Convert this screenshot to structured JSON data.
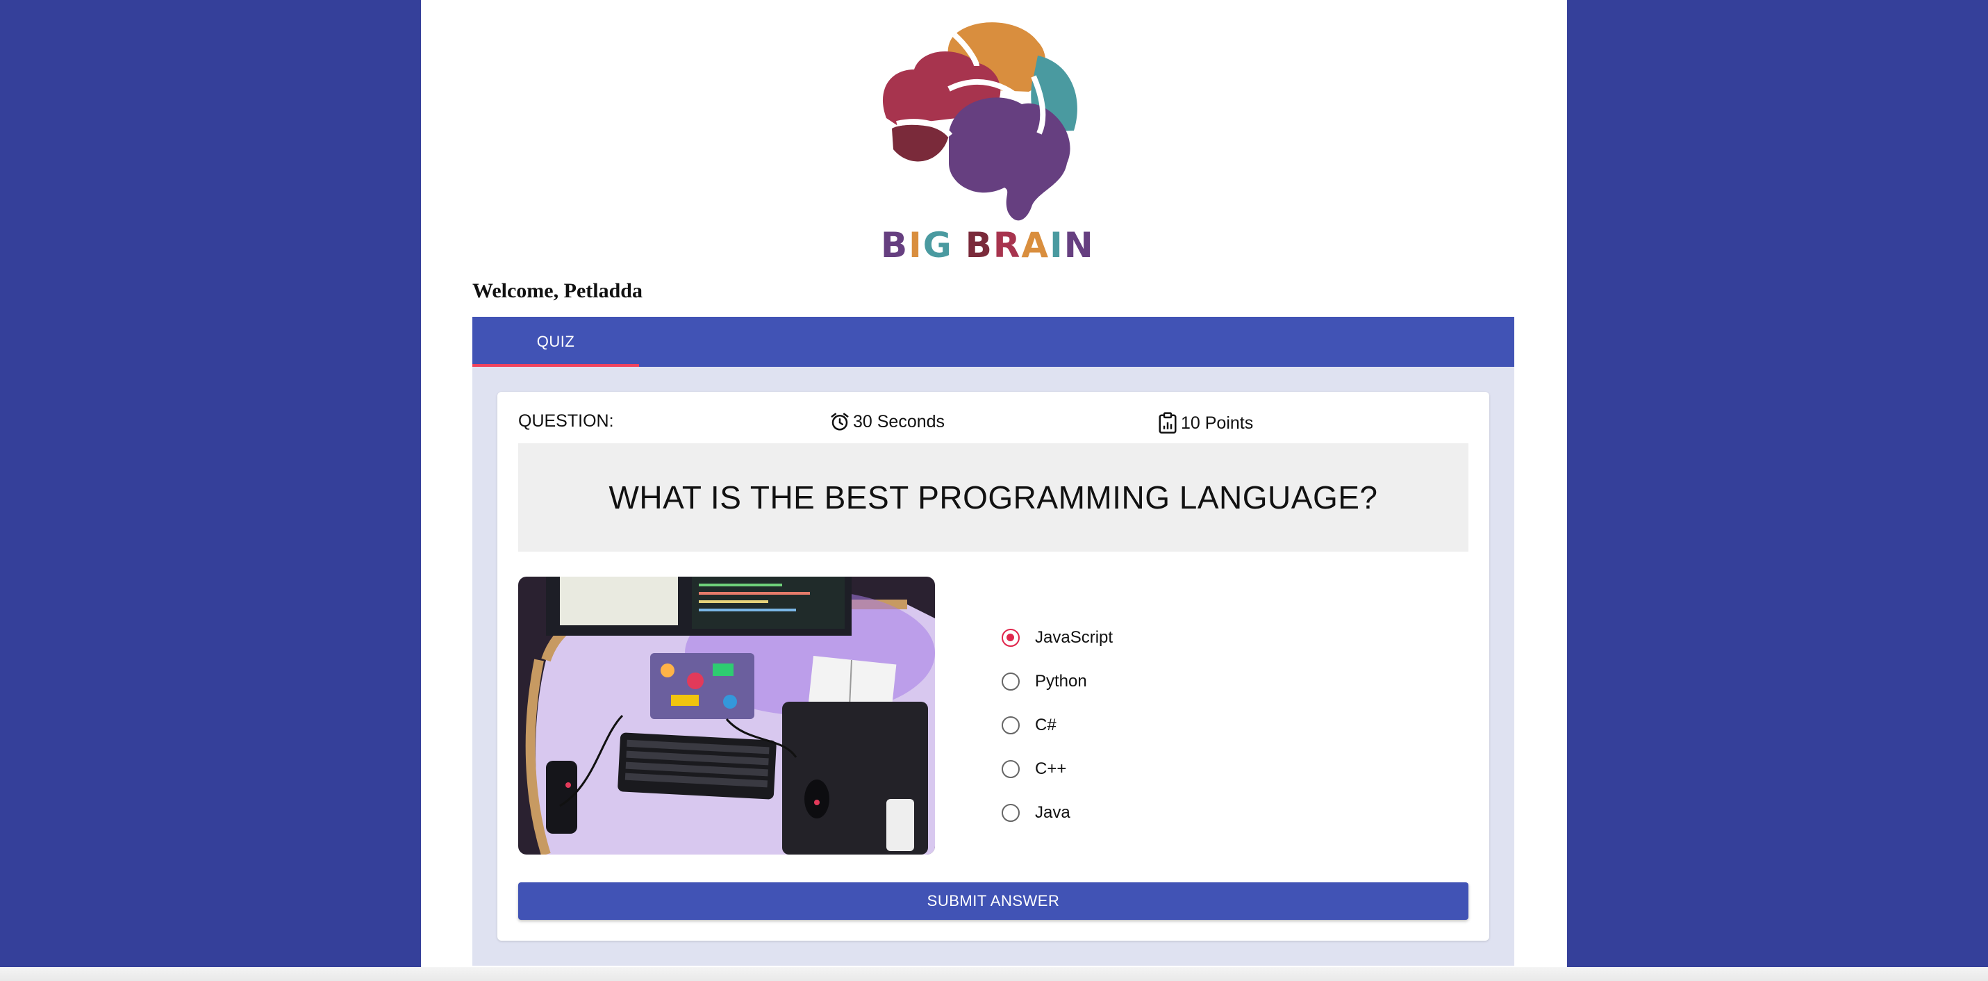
{
  "brand": {
    "logo_text": "BIG BRAIN"
  },
  "welcome": "Welcome, Petladda",
  "tabs": [
    {
      "label": "QUIZ",
      "active": true
    }
  ],
  "question": {
    "label": "QUESTION:",
    "timer": "30 Seconds",
    "points": "10 Points",
    "text": "WHAT IS THE BEST PROGRAMMING LANGUAGE?",
    "image": "desk-setup-photo",
    "options": [
      {
        "label": "JavaScript",
        "selected": true
      },
      {
        "label": "Python",
        "selected": false
      },
      {
        "label": "C#",
        "selected": false
      },
      {
        "label": "C++",
        "selected": false
      },
      {
        "label": "Java",
        "selected": false
      }
    ],
    "submit_label": "SUBMIT ANSWER"
  },
  "colors": {
    "background": "#35409a",
    "primary": "#4153b5",
    "accent": "#e0264c",
    "panel": "#dfe2f1"
  }
}
